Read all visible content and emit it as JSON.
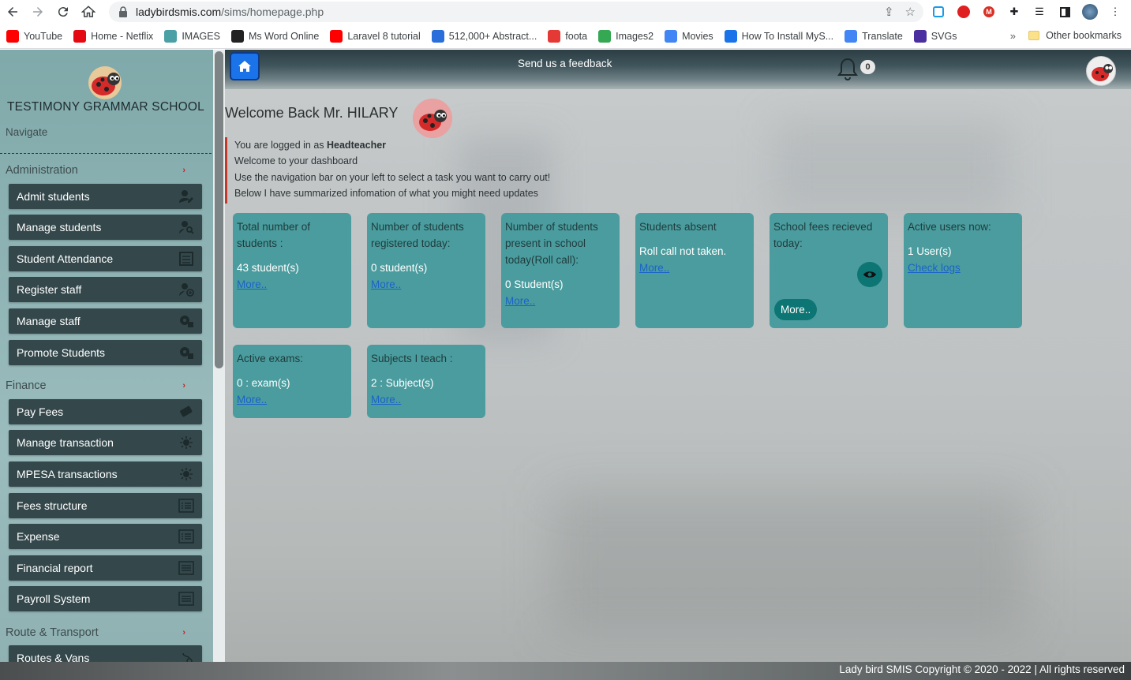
{
  "browser": {
    "url_domain": "ladybirdsmis.com",
    "url_path": "/sims/homepage.php",
    "bookmarks": [
      {
        "label": "YouTube",
        "icon": "youtube-icon",
        "color": "#ff0000"
      },
      {
        "label": "Home - Netflix",
        "icon": "netflix-icon",
        "color": "#e50914"
      },
      {
        "label": "IMAGES",
        "icon": "images-icon",
        "color": "#4aa0a4"
      },
      {
        "label": "Ms Word Online",
        "icon": "word-icon",
        "color": "#222222"
      },
      {
        "label": "Laravel 8 tutorial",
        "icon": "youtube-icon",
        "color": "#ff0000"
      },
      {
        "label": "512,000+ Abstract...",
        "icon": "abstract-icon",
        "color": "#2a6edb"
      },
      {
        "label": "foota",
        "icon": "foota-icon",
        "color": "#e53935"
      },
      {
        "label": "Images2",
        "icon": "px-icon",
        "color": "#34a853"
      },
      {
        "label": "Movies",
        "icon": "movies-icon",
        "color": "#4285f4"
      },
      {
        "label": "How To Install MyS...",
        "icon": "wix-icon",
        "color": "#1a73e8"
      },
      {
        "label": "Translate",
        "icon": "translate-icon",
        "color": "#4285f4"
      },
      {
        "label": "SVGs",
        "icon": "svgs-icon",
        "color": "#4b2fa0"
      }
    ],
    "more": "»",
    "other_bookmarks": "Other bookmarks"
  },
  "sidebar": {
    "school_name": "TESTIMONY GRAMMAR SCHOOL",
    "navigate": "Navigate",
    "sections": [
      {
        "label": "Administration",
        "chevron": "›"
      },
      {
        "label": "Finance",
        "chevron": "›"
      },
      {
        "label": "Route & Transport",
        "chevron": "›"
      }
    ],
    "admin_items": [
      "Admit students",
      "Manage students",
      "Student Attendance",
      "Register staff",
      "Manage staff",
      "Promote Students"
    ],
    "finance_items": [
      "Pay Fees",
      "Manage transaction",
      "MPESA transactions",
      "Fees structure",
      "Expense",
      "Financial report",
      "Payroll System"
    ],
    "transport_items": [
      "Routes & Vans"
    ]
  },
  "topbar": {
    "feedback": "Send us a feedback",
    "notification_count": "0"
  },
  "main": {
    "welcome": "Welcome Back Mr. HILARY",
    "info_prefix": "You are logged in as ",
    "role": "Headteacher",
    "info_lines": [
      "Welcome to your dashboard",
      "Use the navigation bar on your left to select a task you want to carry out!",
      "Below I have summarized infomation of what you might need updates"
    ],
    "cards": [
      {
        "title": "Total number of students :",
        "value": "43 student(s)",
        "link": "More.."
      },
      {
        "title": "Number of students registered today:",
        "value": "0 student(s)",
        "link": "More.."
      },
      {
        "title": "Number of students present in school today(Roll call):",
        "value": "0 Student(s)",
        "link": "More.."
      },
      {
        "title": "Students absent",
        "value": "Roll call not taken.",
        "link": "More.."
      },
      {
        "title": "School fees recieved today:",
        "value": "",
        "link": "More.."
      },
      {
        "title": "Active users now:",
        "value": "1 User(s)",
        "link": "Check logs"
      },
      {
        "title": "Active exams:",
        "value": "0 : exam(s)",
        "link": "More.."
      },
      {
        "title": "Subjects I teach :",
        "value": "2 : Subject(s)",
        "link": "More.."
      }
    ]
  },
  "footer": {
    "text": "Lady bird SMIS Copyright © 2020 - 2022 | All rights reserved"
  },
  "colors": {
    "accent_blue": "#1a73e8",
    "sidebar_item": "#34484c",
    "card_bg": "#4b9c9e",
    "card_button": "#0d7573",
    "section_chevron": "#cc2222"
  }
}
